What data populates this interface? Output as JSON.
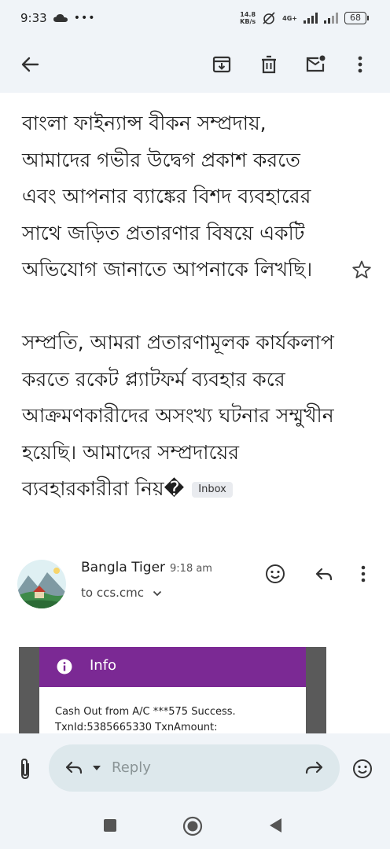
{
  "status": {
    "time": "9:33",
    "net_speed_top": "14.8",
    "net_speed_bottom": "KB/s",
    "network": "4G+",
    "battery": "68"
  },
  "toolbar": {
    "back_icon": "arrow-left-icon",
    "archive_icon": "archive-icon",
    "delete_icon": "trash-icon",
    "mark_unread_icon": "mark-unread-icon",
    "more_icon": "more-vert-icon"
  },
  "email": {
    "body_para1": "বাংলা ফাইন্যান্স বীকন সম্প্রদায়, আমাদের গভীর উদ্বেগ প্রকাশ করতে এবং আপনার ব্যাঙ্কের বিশদ ব্যবহারের সাথে জড়িত প্রতারণার বিষয়ে একটি অভিযোগ জানাতে আপনাকে লিখছি।",
    "body_para2": "সম্প্রতি, আমরা প্রতারণামূলক কার্যকলাপ করতে রকেট প্ল্যাটফর্ম ব্যবহার করে আক্রমণকারীদের অসংখ্য ঘটনার সম্মুখীন হয়েছি। আমাদের সম্প্রদায়ের ব্যবহারকারীরা নিয়�",
    "label_chip": "Inbox"
  },
  "message": {
    "sender_name": "Bangla Tiger",
    "time": "9:18 am",
    "to_line": "to ccs.cmc"
  },
  "attachment": {
    "info_label": "Info",
    "line1": "Cash Out from A/C ***575 Success.",
    "line2": "TxnId:5385665330 TxnAmount:"
  },
  "reply": {
    "placeholder": "Reply"
  },
  "colors": {
    "chrome_bg": "#f0f4f8",
    "info_purple": "#7b2994",
    "reply_pill": "#dde8ec"
  }
}
